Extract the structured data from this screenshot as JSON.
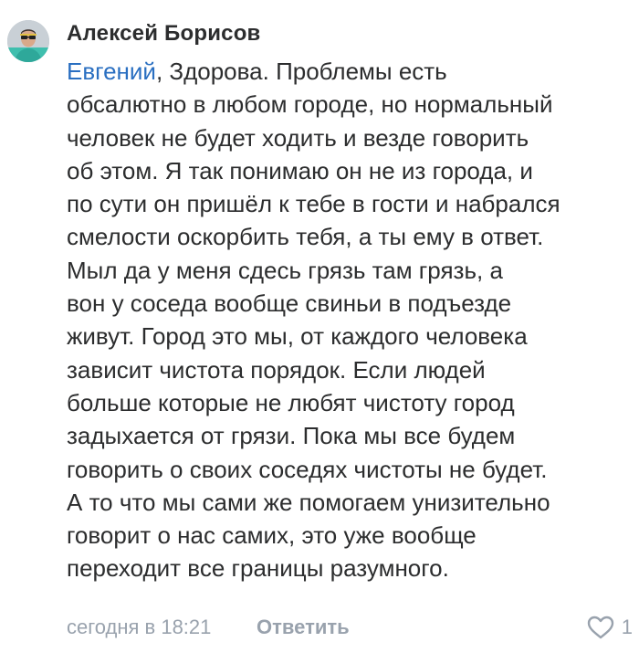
{
  "comment": {
    "author": "Алексей Борисов",
    "mention": "Евгений",
    "lines": [
      ", Здорова. Проблемы есть",
      "обсалютно в любом городе, но нормальный",
      "человек не будет ходить и везде говорить",
      "об этом. Я так понимаю он не из города, и",
      "по сути он пришёл к тебе в гости и набрался",
      "смелости оскорбить тебя, а ты ему в ответ.",
      "Мыл да у меня сдесь грязь там грязь, а",
      "вон у соседа вообще свиньи в подъезде",
      "живут. Город это мы, от каждого человека",
      "зависит чистота порядок. Если людей",
      "больше которые не любят чистоту город",
      "задыхается от грязи. Пока мы все будем",
      "говорить о своих соседях чистоты не будет.",
      "А то что мы сами же помогаем унизительно",
      "говорит о нас самих, это уже вообще",
      "переходит все границы разумного."
    ],
    "timestamp": "сегодня в 18:21",
    "reply_label": "Ответить",
    "likes": "1",
    "icons": {
      "avatar": "user-avatar",
      "like": "heart-outline-icon"
    },
    "colors": {
      "text": "#2c2d2e",
      "mention": "#2a6fc1",
      "secondary": "#99a2ad"
    }
  }
}
